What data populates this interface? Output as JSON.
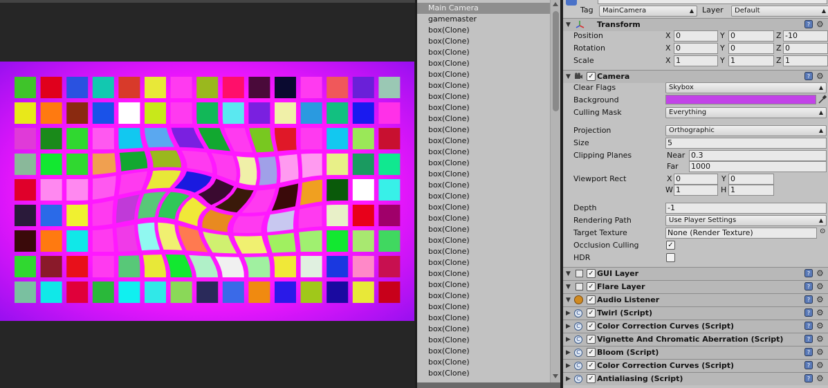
{
  "hierarchy": {
    "items": [
      "Main Camera",
      "gamemaster",
      "box(Clone)",
      "box(Clone)",
      "box(Clone)",
      "box(Clone)",
      "box(Clone)",
      "box(Clone)",
      "box(Clone)",
      "box(Clone)",
      "box(Clone)",
      "box(Clone)",
      "box(Clone)",
      "box(Clone)",
      "box(Clone)",
      "box(Clone)",
      "box(Clone)",
      "box(Clone)",
      "box(Clone)",
      "box(Clone)",
      "box(Clone)",
      "box(Clone)",
      "box(Clone)",
      "box(Clone)",
      "box(Clone)",
      "box(Clone)",
      "box(Clone)",
      "box(Clone)",
      "box(Clone)",
      "box(Clone)",
      "box(Clone)",
      "box(Clone)",
      "box(Clone)",
      "box(Clone)"
    ],
    "selected_index": 0
  },
  "inspector": {
    "tag_label": "Tag",
    "tag_value": "MainCamera",
    "layer_label": "Layer",
    "layer_value": "Default",
    "transform": {
      "title": "Transform",
      "position_label": "Position",
      "position": {
        "x": "0",
        "y": "0",
        "z": "-10"
      },
      "rotation_label": "Rotation",
      "rotation": {
        "x": "0",
        "y": "0",
        "z": "0"
      },
      "scale_label": "Scale",
      "scale": {
        "x": "1",
        "y": "1",
        "z": "1"
      }
    },
    "axis": {
      "x": "X",
      "y": "Y",
      "z": "Z",
      "w": "W",
      "h": "H"
    },
    "camera": {
      "title": "Camera",
      "clear_flags_label": "Clear Flags",
      "clear_flags": "Skybox",
      "background_label": "Background",
      "background_color": "#c243e8",
      "culling_mask_label": "Culling Mask",
      "culling_mask": "Everything",
      "projection_label": "Projection",
      "projection": "Orthographic",
      "size_label": "Size",
      "size": "5",
      "clipping_label": "Clipping Planes",
      "near_label": "Near",
      "near": "0.3",
      "far_label": "Far",
      "far": "1000",
      "viewport_label": "Viewport Rect",
      "viewport": {
        "x": "0",
        "y": "0",
        "w": "1",
        "h": "1"
      },
      "depth_label": "Depth",
      "depth": "-1",
      "rendering_path_label": "Rendering Path",
      "rendering_path": "Use Player Settings",
      "target_texture_label": "Target Texture",
      "target_texture": "None (Render Texture)",
      "occlusion_label": "Occlusion Culling",
      "occlusion": true,
      "hdr_label": "HDR",
      "hdr": false
    },
    "components": [
      "GUI Layer",
      "Flare Layer",
      "Audio Listener",
      "Twirl (Script)",
      "Color Correction Curves (Script)",
      "Vignette And Chromatic Aberration (Script)",
      "Bloom (Script)",
      "Color Correction Curves (Script)",
      "Antialiasing (Script)"
    ]
  },
  "game": {
    "background_color": "#ff18ff",
    "glow_color": "#b010ff",
    "tiles": [
      [
        "#3fc42a",
        "#e0001c",
        "#2a52e0",
        "#12c8b0",
        "#d83a2a",
        "#e8e838",
        "#ff3af0",
        "#9ab81e",
        "#ff0f6a",
        "#4a0a3a",
        "#0a0a30",
        "#ff3af0",
        "#f0585a",
        "#6a20d8",
        "#9ac8b4"
      ],
      [
        "#e8e81a",
        "#ff7a10",
        "#8a2a10",
        "#1a52e8",
        "#ffffff",
        "#c8e81a",
        "#ff3af0",
        "#12b858",
        "#5ae8f0",
        "#7a20e0",
        "#f0f0a8",
        "#2a9ae0",
        "#12c080",
        "#1a1aef",
        "#ff30e8"
      ],
      [
        "#e03ad8",
        "#1a8a1a",
        "#30d830",
        "#ff58f0",
        "#12c8f0",
        "#5aa8f0",
        "#7a20e0",
        "#12a830",
        "#ff3af0",
        "#78c820",
        "#e01828",
        "#ff3af0",
        "#12c8f0",
        "#9ae858",
        "#c81030"
      ],
      [
        "#8ab89a",
        "#12e830",
        "#30d830",
        "#f0a050",
        "#12a830",
        "#9ab81e",
        "#ff3af0",
        "#ff3af0",
        "#f0f0a8",
        "#a0a0e8",
        "#ff9af0",
        "#ff9af0",
        "#e8f088",
        "#1a9a60",
        "#10e890"
      ],
      [
        "#e0002a",
        "#ff88f0",
        "#ff88f0",
        "#ff58f0",
        "#ff3af0",
        "#e8e838",
        "#1a1ae0",
        "#3a0a30",
        "#3a1a0a",
        "#ff3af0",
        "#3a0a0a",
        "#f0a020",
        "#0a5a0a",
        "#ffffff",
        "#38f0e8"
      ],
      [
        "#2a1a3a",
        "#2a6ae8",
        "#f0f030",
        "#ff3af0",
        "#c03ad8",
        "#58c878",
        "#30c858",
        "#f0e838",
        "#e88a20",
        "#ff3af0",
        "#c8c8f0",
        "#ff3af0",
        "#e8f0c8",
        "#e8001a",
        "#a0006a"
      ],
      [
        "#3a0a0a",
        "#ff7a10",
        "#10e8e8",
        "#ff3af0",
        "#f03ae8",
        "#90f8f0",
        "#f0f070",
        "#ff7a50",
        "#d0f070",
        "#f0f070",
        "#a0f060",
        "#a0f070",
        "#12e830",
        "#a8e870",
        "#40d860"
      ],
      [
        "#30d830",
        "#8a1a2a",
        "#e8101a",
        "#ff3af0",
        "#58c878",
        "#e8e838",
        "#12e830",
        "#b0f0c8",
        "#f0f0f0",
        "#a0f0a0",
        "#f0e838",
        "#e0f0e0",
        "#1a38e0",
        "#ff88c8",
        "#c81050"
      ],
      [
        "#7ac0a0",
        "#10e8e8",
        "#e0003a",
        "#2ab83a",
        "#10f0f0",
        "#30e8e8",
        "#8ad858",
        "#2a2a5a",
        "#3a6ae8",
        "#f08a10",
        "#2a1ae8",
        "#a0c81a",
        "#1a0aa0",
        "#e8e838",
        "#c8001a"
      ]
    ]
  }
}
